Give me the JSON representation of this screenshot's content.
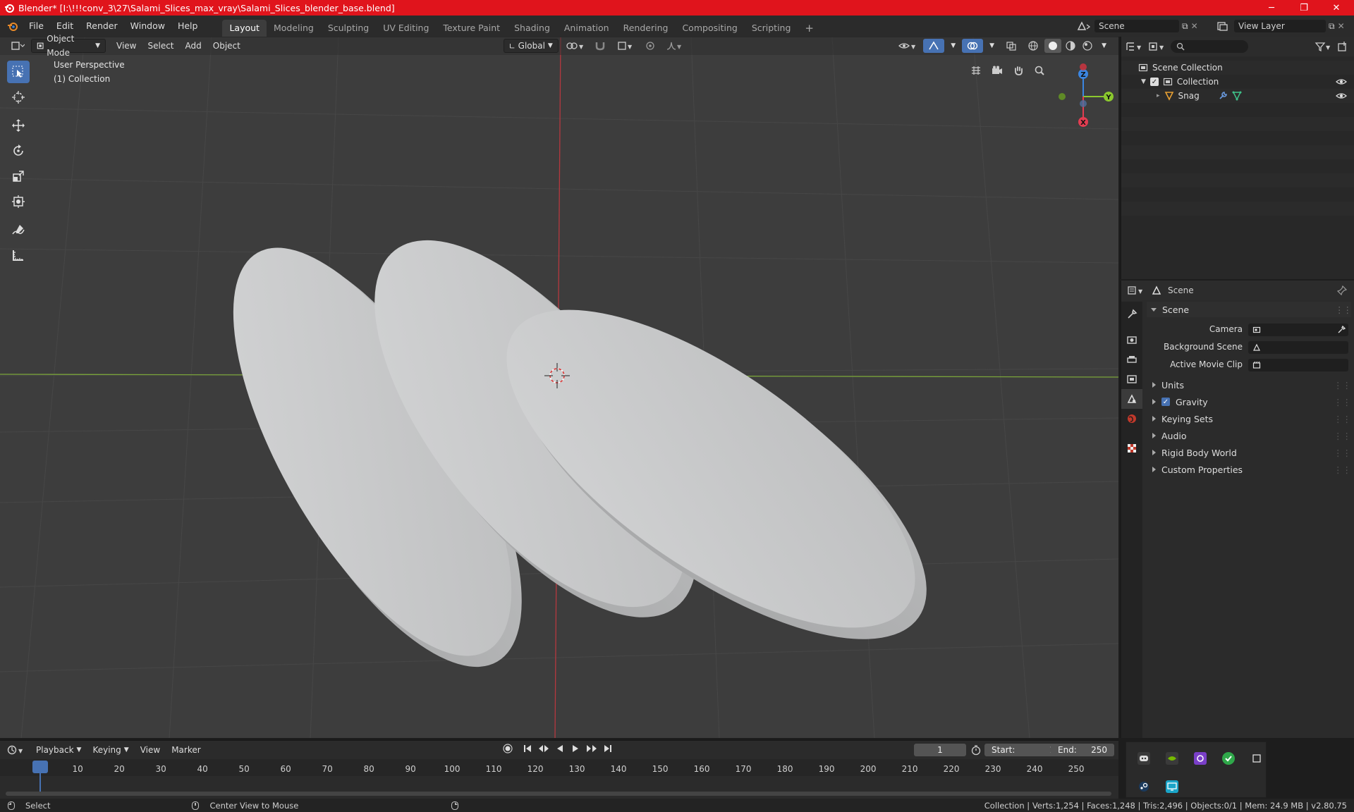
{
  "window": {
    "title": "Blender* [I:\\!!!conv_3\\27\\Salami_Slices_max_vray\\Salami_Slices_blender_base.blend]",
    "minimize": "─",
    "maximize": "❐",
    "close": "✕"
  },
  "menu": [
    "File",
    "Edit",
    "Render",
    "Window",
    "Help"
  ],
  "workspaces": [
    "Layout",
    "Modeling",
    "Sculpting",
    "UV Editing",
    "Texture Paint",
    "Shading",
    "Animation",
    "Rendering",
    "Compositing",
    "Scripting"
  ],
  "add_workspace": "+",
  "scene_selector": {
    "value": "Scene"
  },
  "view_layer_selector": {
    "value": "View Layer"
  },
  "viewport": {
    "mode": "Object Mode",
    "menus": [
      "View",
      "Select",
      "Add",
      "Object"
    ],
    "orientation": "Global",
    "info_line1": "User Perspective",
    "info_line2": "(1) Collection",
    "gizmo_axes": {
      "z": "Z",
      "y": "Y",
      "x": "X"
    }
  },
  "outliner": {
    "search_placeholder": "",
    "root": "Scene Collection",
    "collection": "Collection",
    "object": "Snag"
  },
  "properties": {
    "header_title": "Scene",
    "panel_title": "Scene",
    "camera_label": "Camera",
    "background_scene_label": "Background Scene",
    "active_movie_clip_label": "Active Movie Clip",
    "sections": [
      "Units",
      "Gravity",
      "Keying Sets",
      "Audio",
      "Rigid Body World",
      "Custom Properties"
    ],
    "gravity_enabled": true
  },
  "timeline": {
    "menus": [
      "Playback",
      "Keying",
      "View",
      "Marker"
    ],
    "current_frame": "1",
    "start_label": "Start:",
    "start_value": "1",
    "end_label": "End:",
    "end_value": "250",
    "ruler": [
      "1",
      "10",
      "20",
      "30",
      "40",
      "50",
      "60",
      "70",
      "80",
      "90",
      "100",
      "110",
      "120",
      "130",
      "140",
      "150",
      "160",
      "170",
      "180",
      "190",
      "200",
      "210",
      "220",
      "230",
      "240",
      "250"
    ]
  },
  "statusbar": {
    "left_action": "Select",
    "middle_action": "Center View to Mouse",
    "stats": "Collection | Verts:1,254 | Faces:1,248 | Tris:2,496 | Objects:0/1 | Mem: 24.9 MB | v2.80.75"
  },
  "colors": {
    "titlebar": "#e0141c",
    "accent_blue": "#4772b3",
    "axis_x": "#e33d51",
    "axis_y": "#8bc82e",
    "axis_z": "#3b86e2"
  }
}
